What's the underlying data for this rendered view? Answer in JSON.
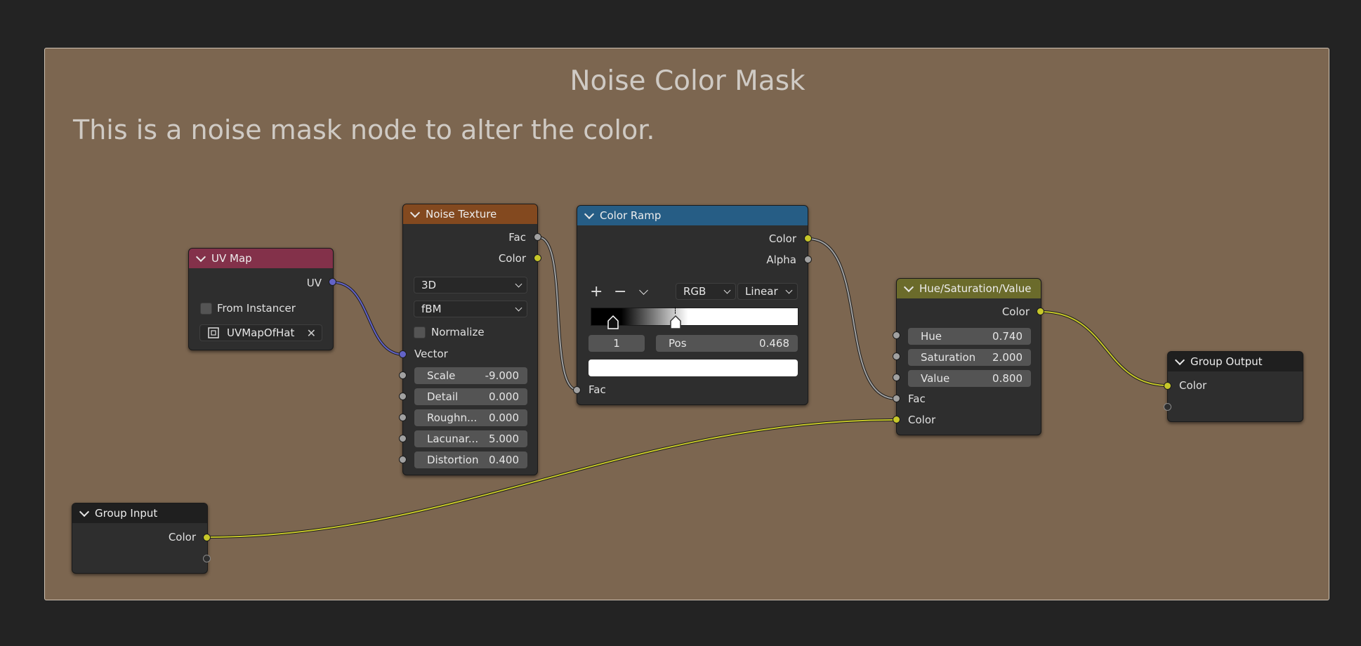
{
  "frame": {
    "title": "Noise Color Mask",
    "text": "This is a noise mask node to alter the color.",
    "color": "#7c6650"
  },
  "nodes": {
    "uv_map": {
      "title": "UV Map",
      "header_color": "#83314a",
      "output": "UV",
      "checkbox_label": "From Instancer",
      "uv_map_value": "UVMapOfHat"
    },
    "noise_texture": {
      "title": "Noise Texture",
      "header_color": "#83491f",
      "outputs": [
        "Fac",
        "Color"
      ],
      "dimensions": "3D",
      "type": "fBM",
      "normalize_label": "Normalize",
      "vector_label": "Vector",
      "fields": [
        {
          "label": "Scale",
          "value": "-9.000"
        },
        {
          "label": "Detail",
          "value": "0.000"
        },
        {
          "label": "Roughn...",
          "value": "0.000"
        },
        {
          "label": "Lacunar...",
          "value": "5.000"
        },
        {
          "label": "Distortion",
          "value": "0.400"
        }
      ]
    },
    "color_ramp": {
      "title": "Color Ramp",
      "header_color": "#265d85",
      "outputs": [
        "Color",
        "Alpha"
      ],
      "add_symbol": "+",
      "remove_symbol": "−",
      "color_mode": "RGB",
      "interpolation": "Linear",
      "stop_index": "1",
      "pos_label": "Pos",
      "pos_value": "0.468",
      "stops": [
        0.08,
        0.468
      ],
      "input": "Fac"
    },
    "hsv": {
      "title": "Hue/Saturation/Value",
      "header_color": "#6b6b2b",
      "output": "Color",
      "fields": [
        {
          "label": "Hue",
          "value": "0.740"
        },
        {
          "label": "Saturation",
          "value": "2.000"
        },
        {
          "label": "Value",
          "value": "0.800"
        }
      ],
      "inputs": [
        "Fac",
        "Color"
      ]
    },
    "group_output": {
      "title": "Group Output",
      "input": "Color"
    },
    "group_input": {
      "title": "Group Input",
      "output": "Color"
    }
  },
  "socket_colors": {
    "vector": "#6363c7",
    "float": "#a1a1a1",
    "color": "#c7c729",
    "empty": "#2e2e2e"
  }
}
